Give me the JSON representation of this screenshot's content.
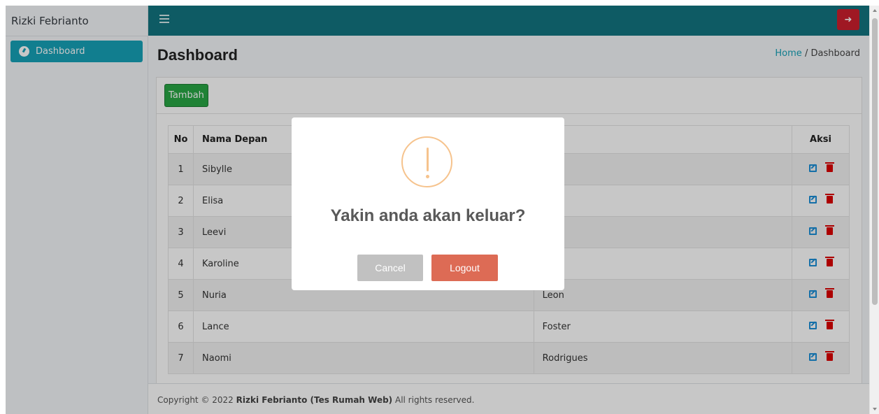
{
  "sidebar": {
    "brand": "Rizki Febrianto",
    "items": [
      {
        "label": "Dashboard",
        "icon": "tachometer-icon",
        "active": true
      }
    ]
  },
  "navbar": {
    "menu_icon": "hamburger-icon",
    "logout_icon": "sign-out-icon",
    "color": "#127581",
    "logout_color": "#cc1f2e"
  },
  "page": {
    "title": "Dashboard",
    "breadcrumb": {
      "home": "Home",
      "separator": "/",
      "current": "Dashboard"
    }
  },
  "card": {
    "add_button": "Tambah"
  },
  "table": {
    "headers": {
      "no": "No",
      "first_name": "Nama Depan",
      "last_name": "",
      "actions": "Aksi"
    },
    "rows": [
      {
        "no": "1",
        "first_name": "Sibylle",
        "last_name": ""
      },
      {
        "no": "2",
        "first_name": "Elisa",
        "last_name": ""
      },
      {
        "no": "3",
        "first_name": "Leevi",
        "last_name": ""
      },
      {
        "no": "4",
        "first_name": "Karoline",
        "last_name": ""
      },
      {
        "no": "5",
        "first_name": "Nuria",
        "last_name": "Leon"
      },
      {
        "no": "6",
        "first_name": "Lance",
        "last_name": "Foster"
      },
      {
        "no": "7",
        "first_name": "Naomi",
        "last_name": "Rodrigues"
      }
    ],
    "edit_icon": "edit-icon",
    "delete_icon": "trash-icon"
  },
  "footer": {
    "prefix": "Copyright © 2022 ",
    "bold": "Rizki Febrianto (Tes Rumah Web)",
    "suffix": " All rights reserved."
  },
  "modal": {
    "icon": "warning-icon",
    "title": "Yakin anda akan keluar?",
    "cancel_label": "Cancel",
    "confirm_label": "Logout",
    "cancel_color": "#c1c1c1",
    "confirm_color": "#dd6b55"
  }
}
